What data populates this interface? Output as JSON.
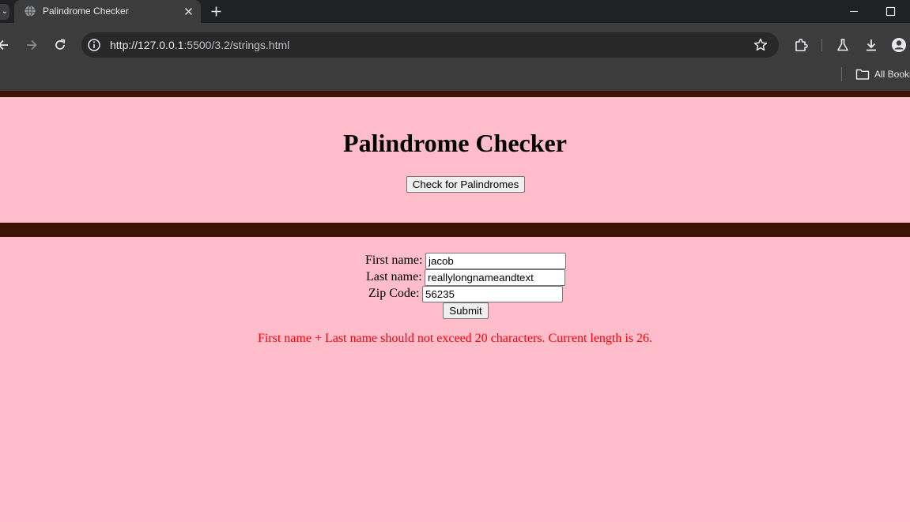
{
  "browser": {
    "tab_title": "Palindrome Checker",
    "url_host": "http://127.0.0.1",
    "url_path": ":5500/3.2/strings.html",
    "bookmarks_label": "All Bookmarks",
    "icons": [
      "tab-menu-icon",
      "globe-icon",
      "close-icon",
      "plus-icon",
      "minimize-icon",
      "maximize-icon",
      "back-icon",
      "forward-icon",
      "reload-icon",
      "info-icon",
      "star-icon",
      "extensions-icon",
      "labs-icon",
      "download-icon",
      "profile-icon",
      "folder-icon"
    ]
  },
  "page": {
    "heading": "Palindrome Checker",
    "check_button": "Check for Palindromes",
    "form": {
      "first_name_label": "First name:",
      "first_name_value": "jacob",
      "last_name_label": "Last name:",
      "last_name_value": "reallylongnameandtext",
      "zip_label": "Zip Code:",
      "zip_value": "56235",
      "submit_label": "Submit"
    },
    "error_message": "First name + Last name should not exceed 20 characters. Current length is 26.",
    "colors": {
      "background": "#ffbccb",
      "rule": "#3d1404",
      "error": "#ff0000"
    }
  }
}
